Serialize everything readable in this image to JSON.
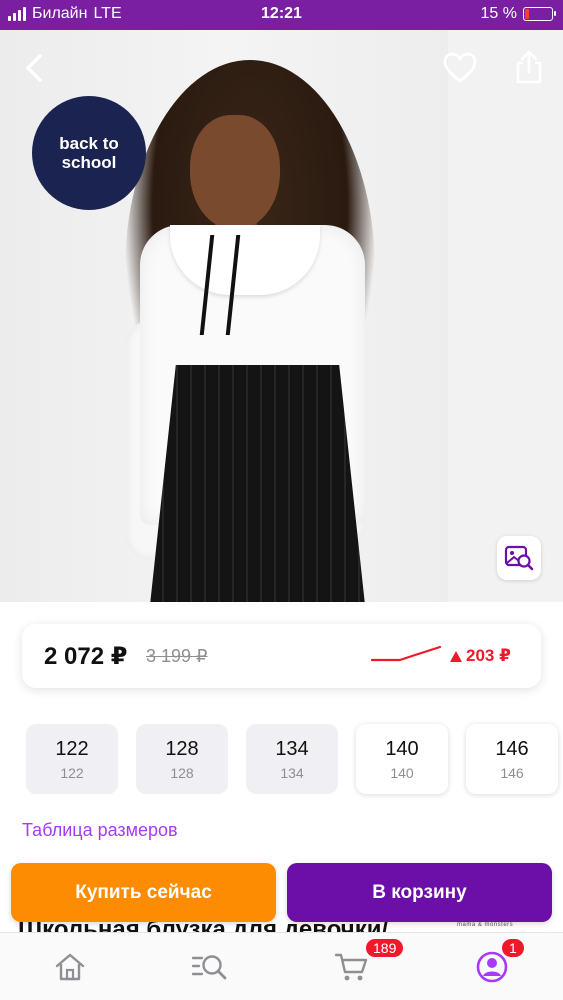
{
  "status_bar": {
    "carrier": "Билайн",
    "network": "LTE",
    "time": "12:21",
    "battery_percent": "15 %",
    "battery_level": 0.15
  },
  "product_image": {
    "badge_text": "back to school",
    "icons": {
      "back": "chevron-left-icon",
      "favorite": "heart-icon",
      "share": "share-icon",
      "visual_search": "image-search-icon"
    }
  },
  "price": {
    "current": "2 072 ₽",
    "old": "3 199 ₽",
    "diff": "203 ₽",
    "diff_color": "#f0192c"
  },
  "sizes": [
    {
      "label": "122",
      "sub": "122",
      "available": false
    },
    {
      "label": "128",
      "sub": "128",
      "available": false
    },
    {
      "label": "134",
      "sub": "134",
      "available": false
    },
    {
      "label": "140",
      "sub": "140",
      "available": true
    },
    {
      "label": "146",
      "sub": "146",
      "available": true
    }
  ],
  "size_table_link": "Таблица размеров",
  "product_title_partial": "Школьная блузка для девочки/",
  "brand_mini": "mama & monsters",
  "actions": {
    "buy_now": "Купить сейчас",
    "add_to_cart": "В корзину",
    "buy_now_color": "#fe8c02",
    "add_to_cart_color": "#6c0ea8"
  },
  "bottom_nav": {
    "items": [
      {
        "name": "home",
        "icon": "home-icon"
      },
      {
        "name": "search",
        "icon": "search-icon"
      },
      {
        "name": "cart",
        "icon": "cart-icon",
        "badge": "189"
      },
      {
        "name": "profile",
        "icon": "profile-icon",
        "badge": "1"
      }
    ]
  },
  "colors": {
    "accent": "#7b1fa2",
    "link": "#a73afd"
  }
}
